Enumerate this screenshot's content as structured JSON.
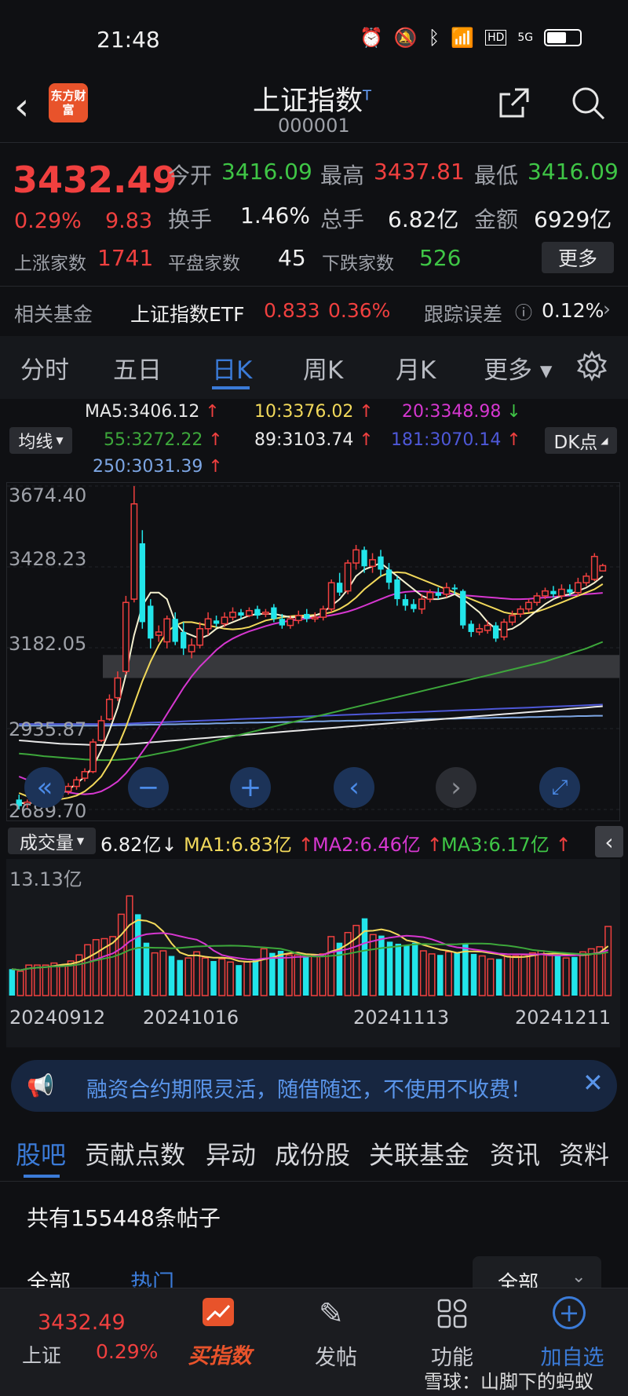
{
  "status_bar": {
    "time": "21:48",
    "hd": "HD",
    "network": "5G"
  },
  "header": {
    "title": "上证指数",
    "title_sup": "T",
    "code": "000001",
    "logo_text": "东方财富"
  },
  "quote": {
    "price": "3432.49",
    "change_pct": "0.29%",
    "change": "9.83",
    "open_label": "今开",
    "open": "3416.09",
    "high_label": "最高",
    "high": "3437.81",
    "low_label": "最低",
    "low": "3416.09",
    "turnover_label": "换手",
    "turnover": "1.46%",
    "volume_label": "总手",
    "volume": "6.82亿",
    "amount_label": "金额",
    "amount": "6929亿",
    "up_label": "上涨家数",
    "up": "1741",
    "flat_label": "平盘家数",
    "flat": "45",
    "down_label": "下跌家数",
    "down": "526",
    "more": "更多"
  },
  "fund": {
    "label": "相关基金",
    "name": "上证指数ETF",
    "price": "0.833",
    "pct": "0.36%",
    "track_label": "跟踪误差",
    "track_value": "0.12%"
  },
  "period_tabs": [
    "分时",
    "五日",
    "日K",
    "周K",
    "月K",
    "更多"
  ],
  "active_period": "日K",
  "ma": {
    "dropdown": "均线",
    "dk": "DK点",
    "ma5": "MA5:3406.12",
    "ma10": "10:3376.02",
    "ma20": "20:3348.98",
    "ma55": "55:3272.22",
    "ma89": "89:3103.74",
    "ma181": "181:3070.14",
    "ma250": "250:3031.39"
  },
  "price_axis": [
    "3674.40",
    "3428.23",
    "3182.05",
    "2935.87",
    "2689.70"
  ],
  "volume_panel": {
    "dropdown": "成交量",
    "value": "6.82亿",
    "ma1": "MA1:6.83亿",
    "ma2": "MA2:6.46亿",
    "ma3": "MA3:6.17亿",
    "axis_top": "13.13亿"
  },
  "date_labels": [
    "20240912",
    "20241016",
    "20241113",
    "20241211"
  ],
  "colors": {
    "up": "#f0403f",
    "down": "#22e5ea",
    "ma5": "#f4f0d0",
    "ma10": "#f2d95b",
    "ma20": "#d637d0",
    "ma55": "#3da73b",
    "ma89": "#e8e8e8",
    "ma181": "#4e58d8",
    "ma250": "#7da6e4"
  },
  "chart_data": {
    "type": "candlestick",
    "ylim": [
      2689.7,
      3674.4
    ],
    "candles": [
      {
        "o": 2720,
        "c": 2700,
        "h": 2735,
        "l": 2690,
        "v": 2.6
      },
      {
        "o": 2705,
        "c": 2712,
        "h": 2720,
        "l": 2695,
        "v": 2.4
      },
      {
        "o": 2715,
        "c": 2725,
        "h": 2740,
        "l": 2705,
        "v": 3.0
      },
      {
        "o": 2725,
        "c": 2730,
        "h": 2745,
        "l": 2715,
        "v": 3.0
      },
      {
        "o": 2728,
        "c": 2735,
        "h": 2750,
        "l": 2718,
        "v": 3.0
      },
      {
        "o": 2730,
        "c": 2745,
        "h": 2760,
        "l": 2722,
        "v": 3.2
      },
      {
        "o": 2745,
        "c": 2760,
        "h": 2770,
        "l": 2735,
        "v": 3.0
      },
      {
        "o": 2760,
        "c": 2780,
        "h": 2790,
        "l": 2750,
        "v": 3.4
      },
      {
        "o": 2785,
        "c": 2805,
        "h": 2815,
        "l": 2775,
        "v": 4.0
      },
      {
        "o": 2805,
        "c": 2895,
        "h": 2905,
        "l": 2800,
        "v": 5.0
      },
      {
        "o": 2900,
        "c": 2960,
        "h": 2975,
        "l": 2895,
        "v": 5.5
      },
      {
        "o": 2965,
        "c": 3025,
        "h": 3040,
        "l": 2960,
        "v": 5.6
      },
      {
        "o": 3030,
        "c": 3090,
        "h": 3110,
        "l": 3020,
        "v": 5.8
      },
      {
        "o": 3110,
        "c": 3320,
        "h": 3340,
        "l": 3100,
        "v": 8.0
      },
      {
        "o": 3330,
        "c": 3620,
        "h": 3674,
        "l": 3320,
        "v": 9.8
      },
      {
        "o": 3500,
        "c": 3260,
        "h": 3540,
        "l": 3240,
        "v": 8.0
      },
      {
        "o": 3310,
        "c": 3210,
        "h": 3330,
        "l": 3180,
        "v": 5.2
      },
      {
        "o": 3220,
        "c": 3230,
        "h": 3250,
        "l": 3200,
        "v": 4.2
      },
      {
        "o": 3200,
        "c": 3270,
        "h": 3280,
        "l": 3180,
        "v": 4.4
      },
      {
        "o": 3270,
        "c": 3200,
        "h": 3290,
        "l": 3190,
        "v": 3.9
      },
      {
        "o": 3230,
        "c": 3180,
        "h": 3260,
        "l": 3160,
        "v": 3.5
      },
      {
        "o": 3170,
        "c": 3190,
        "h": 3210,
        "l": 3150,
        "v": 3.7
      },
      {
        "o": 3190,
        "c": 3240,
        "h": 3260,
        "l": 3180,
        "v": 4.3
      },
      {
        "o": 3240,
        "c": 3270,
        "h": 3290,
        "l": 3220,
        "v": 3.7
      },
      {
        "o": 3265,
        "c": 3255,
        "h": 3280,
        "l": 3245,
        "v": 3.4
      },
      {
        "o": 3255,
        "c": 3275,
        "h": 3290,
        "l": 3245,
        "v": 3.6
      },
      {
        "o": 3275,
        "c": 3290,
        "h": 3305,
        "l": 3265,
        "v": 3.3
      },
      {
        "o": 3290,
        "c": 3280,
        "h": 3300,
        "l": 3270,
        "v": 3.0
      },
      {
        "o": 3280,
        "c": 3295,
        "h": 3305,
        "l": 3275,
        "v": 3.3
      },
      {
        "o": 3300,
        "c": 3280,
        "h": 3310,
        "l": 3270,
        "v": 3.6
      },
      {
        "o": 3285,
        "c": 3290,
        "h": 3300,
        "l": 3275,
        "v": 4.6
      },
      {
        "o": 3305,
        "c": 3270,
        "h": 3315,
        "l": 3260,
        "v": 4.2
      },
      {
        "o": 3270,
        "c": 3250,
        "h": 3285,
        "l": 3240,
        "v": 4.4
      },
      {
        "o": 3250,
        "c": 3270,
        "h": 3280,
        "l": 3240,
        "v": 4.0
      },
      {
        "o": 3265,
        "c": 3280,
        "h": 3295,
        "l": 3255,
        "v": 4.0
      },
      {
        "o": 3285,
        "c": 3270,
        "h": 3300,
        "l": 3260,
        "v": 3.8
      },
      {
        "o": 3270,
        "c": 3275,
        "h": 3290,
        "l": 3260,
        "v": 4.0
      },
      {
        "o": 3275,
        "c": 3300,
        "h": 3310,
        "l": 3265,
        "v": 4.1
      },
      {
        "o": 3300,
        "c": 3380,
        "h": 3390,
        "l": 3290,
        "v": 5.8
      },
      {
        "o": 3380,
        "c": 3350,
        "h": 3410,
        "l": 3340,
        "v": 5.2
      },
      {
        "o": 3355,
        "c": 3440,
        "h": 3450,
        "l": 3345,
        "v": 6.2
      },
      {
        "o": 3440,
        "c": 3480,
        "h": 3495,
        "l": 3420,
        "v": 6.9
      },
      {
        "o": 3480,
        "c": 3430,
        "h": 3490,
        "l": 3410,
        "v": 7.6
      },
      {
        "o": 3430,
        "c": 3450,
        "h": 3470,
        "l": 3410,
        "v": 6.0
      },
      {
        "o": 3460,
        "c": 3420,
        "h": 3480,
        "l": 3400,
        "v": 5.9
      },
      {
        "o": 3420,
        "c": 3380,
        "h": 3440,
        "l": 3360,
        "v": 5.3
      },
      {
        "o": 3390,
        "c": 3330,
        "h": 3400,
        "l": 3310,
        "v": 5.1
      },
      {
        "o": 3330,
        "c": 3310,
        "h": 3345,
        "l": 3295,
        "v": 4.9
      },
      {
        "o": 3315,
        "c": 3300,
        "h": 3330,
        "l": 3290,
        "v": 5.2
      },
      {
        "o": 3300,
        "c": 3330,
        "h": 3345,
        "l": 3285,
        "v": 4.4
      },
      {
        "o": 3330,
        "c": 3350,
        "h": 3360,
        "l": 3320,
        "v": 4.1
      },
      {
        "o": 3350,
        "c": 3340,
        "h": 3365,
        "l": 3330,
        "v": 4.0
      },
      {
        "o": 3345,
        "c": 3365,
        "h": 3380,
        "l": 3335,
        "v": 4.3
      },
      {
        "o": 3365,
        "c": 3360,
        "h": 3375,
        "l": 3345,
        "v": 4.2
      },
      {
        "o": 3355,
        "c": 3250,
        "h": 3360,
        "l": 3240,
        "v": 5.1
      },
      {
        "o": 3255,
        "c": 3230,
        "h": 3265,
        "l": 3215,
        "v": 4.1
      },
      {
        "o": 3230,
        "c": 3240,
        "h": 3255,
        "l": 3220,
        "v": 3.9
      },
      {
        "o": 3235,
        "c": 3250,
        "h": 3265,
        "l": 3225,
        "v": 3.6
      },
      {
        "o": 3250,
        "c": 3210,
        "h": 3260,
        "l": 3200,
        "v": 3.6
      },
      {
        "o": 3215,
        "c": 3260,
        "h": 3270,
        "l": 3205,
        "v": 3.9
      },
      {
        "o": 3260,
        "c": 3280,
        "h": 3295,
        "l": 3250,
        "v": 3.9
      },
      {
        "o": 3285,
        "c": 3300,
        "h": 3310,
        "l": 3275,
        "v": 4.0
      },
      {
        "o": 3300,
        "c": 3320,
        "h": 3330,
        "l": 3290,
        "v": 4.2
      },
      {
        "o": 3320,
        "c": 3340,
        "h": 3350,
        "l": 3310,
        "v": 4.4
      },
      {
        "o": 3340,
        "c": 3355,
        "h": 3365,
        "l": 3330,
        "v": 4.1
      },
      {
        "o": 3355,
        "c": 3345,
        "h": 3370,
        "l": 3335,
        "v": 4.0
      },
      {
        "o": 3340,
        "c": 3360,
        "h": 3375,
        "l": 3330,
        "v": 3.7
      },
      {
        "o": 3360,
        "c": 3350,
        "h": 3375,
        "l": 3340,
        "v": 3.8
      },
      {
        "o": 3350,
        "c": 3380,
        "h": 3395,
        "l": 3340,
        "v": 4.3
      },
      {
        "o": 3380,
        "c": 3400,
        "h": 3410,
        "l": 3370,
        "v": 4.6
      },
      {
        "o": 3390,
        "c": 3460,
        "h": 3470,
        "l": 3385,
        "v": 4.8
      },
      {
        "o": 3416,
        "c": 3432,
        "h": 3438,
        "l": 3416,
        "v": 6.8
      }
    ],
    "ma_lines": {
      "ma5": [
        2710,
        2708,
        2712,
        2718,
        2726,
        2736,
        2750,
        2768,
        2790,
        2820,
        2870,
        2930,
        3000,
        3100,
        3220,
        3310,
        3350,
        3350,
        3330,
        3260,
        3230,
        3220,
        3210,
        3220,
        3240,
        3250,
        3260,
        3270,
        3280,
        3285,
        3285,
        3285,
        3280,
        3275,
        3275,
        3275,
        3280,
        3290,
        3310,
        3330,
        3360,
        3400,
        3420,
        3430,
        3440,
        3420,
        3400,
        3380,
        3360,
        3340,
        3330,
        3330,
        3335,
        3345,
        3330,
        3310,
        3290,
        3260,
        3240,
        3235,
        3240,
        3255,
        3275,
        3295,
        3315,
        3330,
        3340,
        3345,
        3355,
        3365,
        3380,
        3400
      ],
      "ma10": [
        2740,
        2730,
        2725,
        2722,
        2720,
        2721,
        2725,
        2732,
        2745,
        2765,
        2790,
        2830,
        2880,
        2940,
        3010,
        3080,
        3140,
        3190,
        3230,
        3250,
        3260,
        3260,
        3255,
        3250,
        3245,
        3240,
        3238,
        3240,
        3245,
        3255,
        3265,
        3270,
        3275,
        3278,
        3280,
        3280,
        3282,
        3285,
        3290,
        3300,
        3315,
        3335,
        3360,
        3380,
        3400,
        3410,
        3412,
        3410,
        3400,
        3390,
        3380,
        3370,
        3360,
        3350,
        3340,
        3330,
        3320,
        3310,
        3300,
        3290,
        3285,
        3285,
        3288,
        3292,
        3300,
        3310,
        3320,
        3330,
        3340,
        3350,
        3360,
        3376
      ],
      "ma20": [
        2790,
        2780,
        2770,
        2762,
        2755,
        2748,
        2742,
        2738,
        2736,
        2738,
        2745,
        2758,
        2775,
        2800,
        2830,
        2865,
        2900,
        2940,
        2980,
        3020,
        3060,
        3095,
        3125,
        3150,
        3175,
        3195,
        3210,
        3222,
        3232,
        3240,
        3248,
        3255,
        3260,
        3265,
        3268,
        3271,
        3274,
        3277,
        3281,
        3286,
        3292,
        3300,
        3310,
        3320,
        3330,
        3340,
        3348,
        3352,
        3354,
        3354,
        3352,
        3350,
        3348,
        3345,
        3342,
        3340,
        3338,
        3336,
        3334,
        3332,
        3330,
        3330,
        3331,
        3333,
        3335,
        3337,
        3339,
        3341,
        3343,
        3345,
        3347,
        3349
      ],
      "ma55": [
        2860,
        2858,
        2855,
        2852,
        2850,
        2848,
        2846,
        2844,
        2842,
        2841,
        2840,
        2840,
        2841,
        2843,
        2846,
        2850,
        2855,
        2860,
        2865,
        2870,
        2876,
        2882,
        2888,
        2894,
        2900,
        2906,
        2912,
        2918,
        2924,
        2930,
        2936,
        2942,
        2948,
        2954,
        2960,
        2966,
        2972,
        2978,
        2984,
        2990,
        2996,
        3002,
        3008,
        3014,
        3020,
        3026,
        3032,
        3038,
        3044,
        3050,
        3056,
        3062,
        3068,
        3074,
        3080,
        3086,
        3092,
        3098,
        3104,
        3110,
        3116,
        3122,
        3128,
        3134,
        3140,
        3148,
        3156,
        3164,
        3172,
        3180,
        3190,
        3200
      ],
      "ma89": [
        2900,
        2898,
        2896,
        2894,
        2892,
        2890,
        2889,
        2888,
        2887,
        2886,
        2886,
        2886,
        2887,
        2888,
        2890,
        2892,
        2894,
        2896,
        2898,
        2900,
        2902,
        2904,
        2906,
        2908,
        2910,
        2912,
        2914,
        2916,
        2918,
        2920,
        2922,
        2924,
        2926,
        2928,
        2930,
        2932,
        2934,
        2936,
        2938,
        2940,
        2942,
        2944,
        2946,
        2948,
        2950,
        2952,
        2954,
        2956,
        2958,
        2960,
        2962,
        2964,
        2966,
        2968,
        2970,
        2972,
        2974,
        2976,
        2978,
        2980,
        2982,
        2984,
        2986,
        2988,
        2990,
        2992,
        2994,
        2996,
        2998,
        3000,
        3002,
        3004
      ],
      "ma181": [
        2950,
        2950,
        2950,
        2950,
        2950,
        2950,
        2950,
        2950,
        2950,
        2950,
        2950,
        2950,
        2950,
        2951,
        2952,
        2953,
        2954,
        2955,
        2956,
        2957,
        2958,
        2959,
        2960,
        2961,
        2962,
        2963,
        2964,
        2965,
        2966,
        2967,
        2968,
        2969,
        2970,
        2971,
        2972,
        2973,
        2974,
        2975,
        2976,
        2977,
        2978,
        2979,
        2980,
        2981,
        2982,
        2983,
        2984,
        2985,
        2986,
        2987,
        2988,
        2989,
        2990,
        2991,
        2992,
        2993,
        2994,
        2995,
        2996,
        2997,
        2998,
        2999,
        3000,
        3001,
        3002,
        3003,
        3004,
        3005,
        3006,
        3007,
        3008,
        3009
      ],
      "ma250": [
        2945,
        2945,
        2945,
        2945,
        2945,
        2945,
        2945,
        2945,
        2945,
        2945,
        2945,
        2945,
        2946,
        2946,
        2947,
        2947,
        2948,
        2948,
        2949,
        2949,
        2950,
        2950,
        2951,
        2951,
        2952,
        2952,
        2953,
        2953,
        2954,
        2954,
        2955,
        2955,
        2956,
        2956,
        2957,
        2957,
        2958,
        2958,
        2959,
        2959,
        2960,
        2960,
        2961,
        2961,
        2962,
        2962,
        2963,
        2963,
        2964,
        2964,
        2965,
        2965,
        2966,
        2966,
        2967,
        2967,
        2968,
        2968,
        2969,
        2969,
        2970,
        2970,
        2971,
        2971,
        2972,
        2972,
        2973,
        2973,
        2974,
        2974,
        2975,
        2975
      ]
    },
    "volume_ylim": [
      0,
      13.13
    ]
  },
  "banner": {
    "text": "融资合约期限灵活，随借随还，不使用不收费！"
  },
  "content_tabs": [
    "股吧",
    "贡献点数",
    "异动",
    "成份股",
    "关联基金",
    "资讯",
    "资料"
  ],
  "active_content_tab": "股吧",
  "post_count": "共有155448条帖子",
  "filters": {
    "all": "全部",
    "hot": "热门",
    "dropdown": "全部"
  },
  "bottom_nav": {
    "index_price": "3432.49",
    "index_name": "上证",
    "index_pct": "0.29%",
    "buy": "买指数",
    "post": "发帖",
    "func": "功能",
    "add": "加自选"
  },
  "watermark": "雪球：山脚下的蚂蚁"
}
